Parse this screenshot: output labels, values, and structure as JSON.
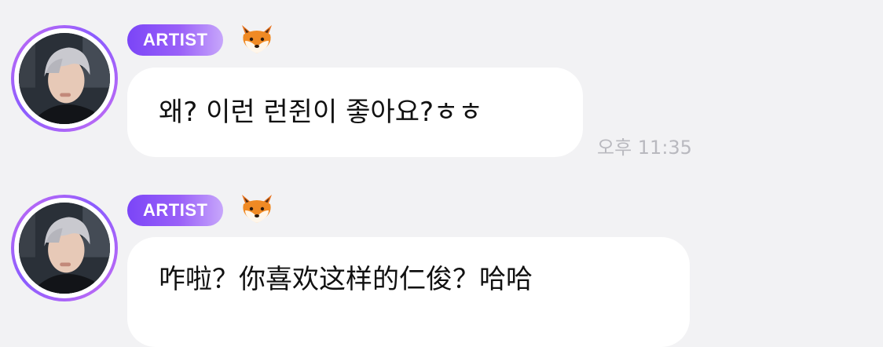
{
  "messages": [
    {
      "badge": "ARTIST",
      "badge_icon": "fox-icon",
      "text": "왜? 이런 런쥔이 좋아요?ㅎㅎ",
      "time": "오후 11:35"
    },
    {
      "badge": "ARTIST",
      "badge_icon": "fox-icon",
      "text": "咋啦？你喜欢这样的仁俊？哈哈",
      "time": ""
    }
  ],
  "colors": {
    "background": "#f2f2f4",
    "bubble": "#ffffff",
    "badge_start": "#7b45f7",
    "badge_end": "#c7a6fb",
    "avatar_ring": "#a56af5",
    "timestamp": "#b9b9bf"
  }
}
